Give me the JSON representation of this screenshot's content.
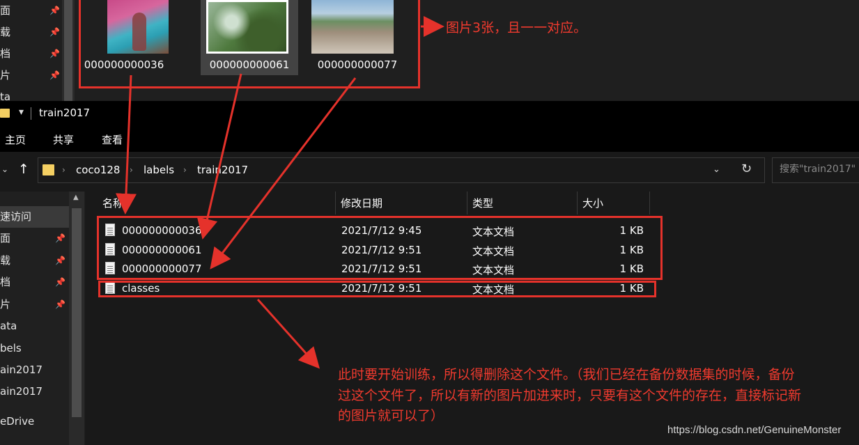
{
  "top_folder": {
    "nav_items": [
      {
        "label": "面"
      },
      {
        "label": "载"
      },
      {
        "label": "档"
      },
      {
        "label": "片"
      },
      {
        "label": "ta"
      }
    ],
    "thumbnails": [
      {
        "label": "000000000036",
        "selected": false
      },
      {
        "label": "000000000061",
        "selected": true
      },
      {
        "label": "000000000077",
        "selected": false
      }
    ]
  },
  "window": {
    "title": "train2017"
  },
  "ribbon": {
    "tabs": [
      "主页",
      "共享",
      "查看"
    ]
  },
  "address": {
    "crumbs": [
      "coco128",
      "labels",
      "train2017"
    ],
    "search_placeholder": "搜索\"train2017\""
  },
  "nav": {
    "items": [
      {
        "label": "速访问",
        "pinned": false,
        "active": true
      },
      {
        "label": "面",
        "pinned": true
      },
      {
        "label": "载",
        "pinned": true
      },
      {
        "label": "档",
        "pinned": true
      },
      {
        "label": "片",
        "pinned": true
      },
      {
        "label": "ata",
        "pinned": false
      },
      {
        "label": "bels",
        "pinned": false
      },
      {
        "label": "ain2017",
        "pinned": false
      },
      {
        "label": "ain2017",
        "pinned": false
      },
      {
        "label": "eDrive",
        "pinned": false
      }
    ]
  },
  "file_list": {
    "columns": [
      "名称",
      "修改日期",
      "类型",
      "大小"
    ],
    "rows": [
      {
        "name": "000000000036",
        "date": "2021/7/12 9:45",
        "type": "文本文档",
        "size": "1 KB"
      },
      {
        "name": "000000000061",
        "date": "2021/7/12 9:51",
        "type": "文本文档",
        "size": "1 KB"
      },
      {
        "name": "000000000077",
        "date": "2021/7/12 9:51",
        "type": "文本文档",
        "size": "1 KB"
      },
      {
        "name": "classes",
        "date": "2021/7/12 9:51",
        "type": "文本文档",
        "size": "1 KB"
      }
    ]
  },
  "annotations": {
    "note_top": "图片3张，且一一对应。",
    "note_bottom_1": "此时要开始训练，所以得删除这个文件。（我们已经在备份数据集的时候，备份",
    "note_bottom_2": "过这个文件了，所以有新的图片加进来时，只要有这个文件的存在，直接标记新",
    "note_bottom_3": "的图片就可以了）",
    "color": "#e5322b"
  },
  "watermark": "https://blog.csdn.net/GenuineMonster"
}
